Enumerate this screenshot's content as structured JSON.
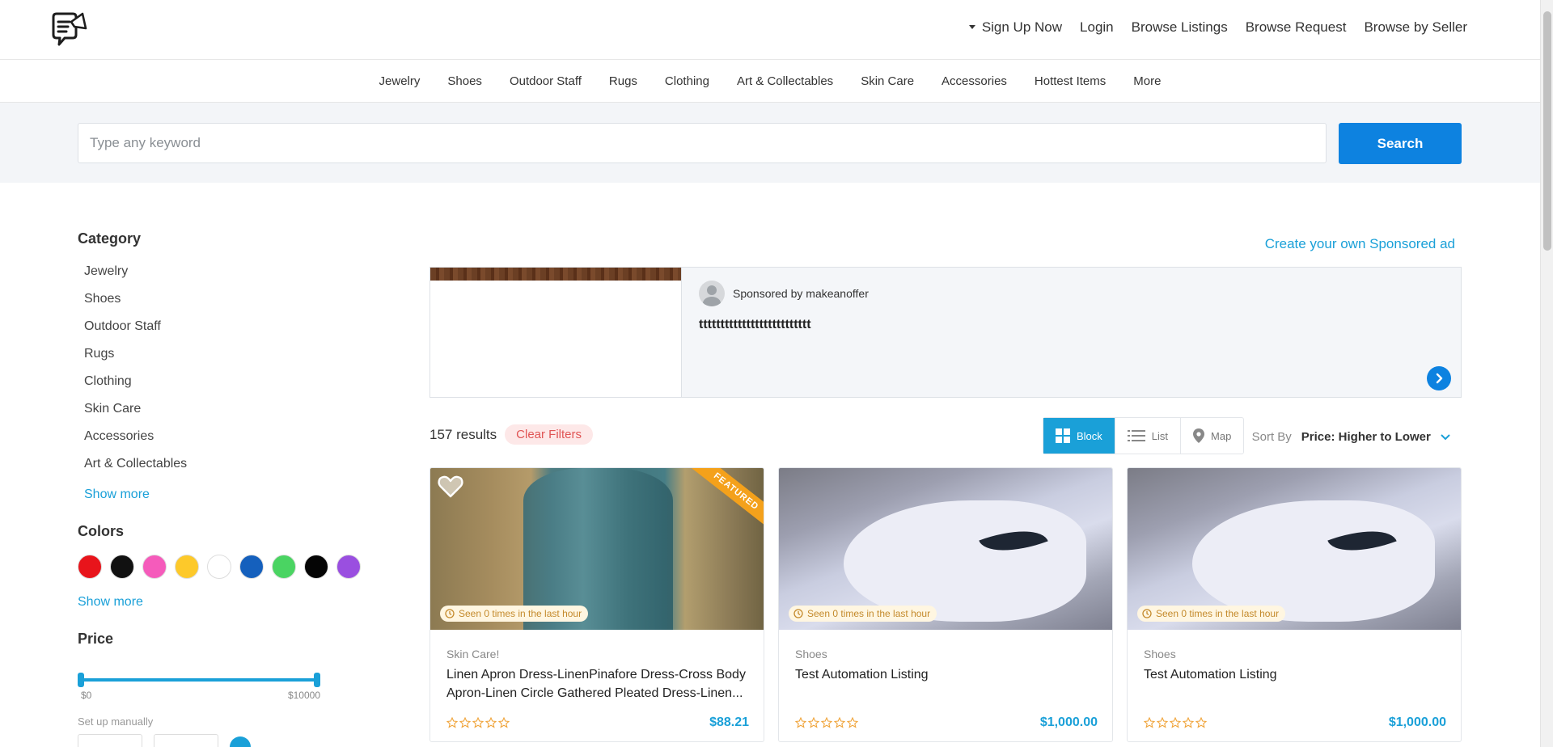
{
  "header": {
    "nav": [
      "Sign Up Now",
      "Login",
      "Browse Listings",
      "Browse Request",
      "Browse by Seller"
    ]
  },
  "category_nav": [
    "Jewelry",
    "Shoes",
    "Outdoor Staff",
    "Rugs",
    "Clothing",
    "Art & Collectables",
    "Skin Care",
    "Accessories",
    "Hottest Items",
    "More"
  ],
  "search": {
    "placeholder": "Type any keyword",
    "button_label": "Search"
  },
  "sidebar": {
    "category_heading": "Category",
    "categories": [
      "Jewelry",
      "Shoes",
      "Outdoor Staff",
      "Rugs",
      "Clothing",
      "Skin Care",
      "Accessories",
      "Art & Collectables"
    ],
    "show_more": "Show more",
    "colors_heading": "Colors",
    "colors": [
      "#e8141b",
      "#111111",
      "#f55bbb",
      "#fdc92a",
      "#ffffff",
      "#1560bd",
      "#4ad462",
      "#050505",
      "#9a4fe0"
    ],
    "colors_show_more": "Show more",
    "price_heading": "Price",
    "price_min_label": "$0",
    "price_max_label": "$10000",
    "price_range": [
      0,
      10000
    ],
    "set_up_manually": "Set up manually"
  },
  "sponsor": {
    "create_link": "Create your own Sponsored ad",
    "sponsored_by": "Sponsored by makeanoffer",
    "title": "tttttttttttttttttttttttttt"
  },
  "results": {
    "count_text": "157 results",
    "clear_filters": "Clear Filters",
    "views": [
      "Block",
      "List",
      "Map"
    ],
    "active_view": "Block",
    "sort_label": "Sort By",
    "sort_value": "Price: Higher to Lower"
  },
  "listings": [
    {
      "category": "Skin Care!",
      "title": "Linen Apron Dress-LinenPinafore Dress-Cross Body Apron-Linen Circle Gathered Pleated Dress-Linen...",
      "price": "$88.21",
      "seen": "Seen 0 times in the last hour",
      "badge": "FEATURED",
      "rating": 0
    },
    {
      "category": "Shoes",
      "title": "Test Automation Listing",
      "price": "$1,000.00",
      "seen": "Seen 0 times in the last hour",
      "rating": 0
    },
    {
      "category": "Shoes",
      "title": "Test Automation Listing",
      "price": "$1,000.00",
      "seen": "Seen 0 times in the last hour",
      "rating": 0
    }
  ],
  "theme": {
    "accent": "#1aa0d8",
    "primary_button": "#0d82e0",
    "featured": "#f4a11b",
    "star": "#f0a43a"
  }
}
